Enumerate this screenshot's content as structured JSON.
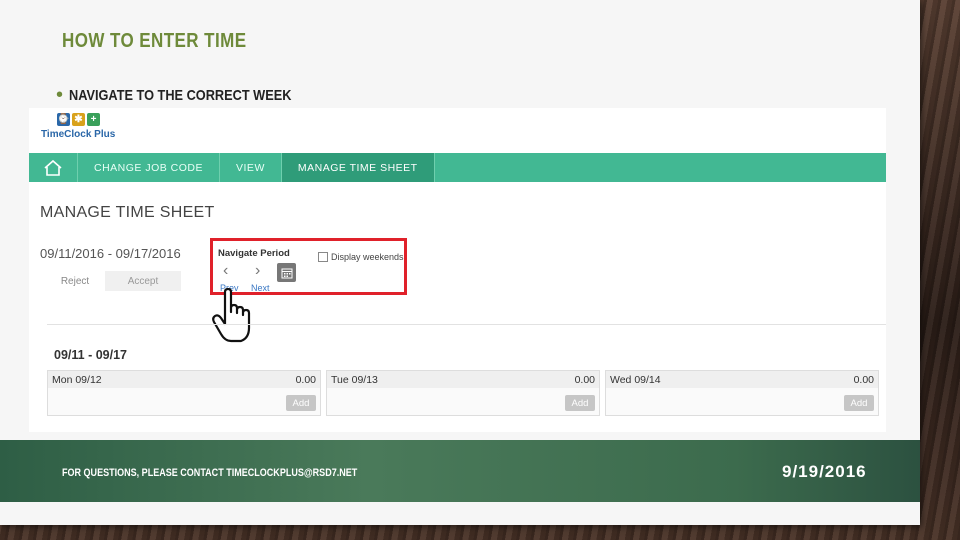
{
  "slide": {
    "title": "HOW TO ENTER TIME",
    "bullet": "NAVIGATE TO THE CORRECT WEEK"
  },
  "app": {
    "logo_text": "TimeClock Plus",
    "nav": {
      "items": [
        {
          "label": "CHANGE  JOB  CODE"
        },
        {
          "label": "VIEW"
        },
        {
          "label": "MANAGE  TIME  SHEET"
        }
      ]
    },
    "page_title": "MANAGE TIME SHEET",
    "period_range": "09/11/2016 - 09/17/2016",
    "reject_label": "Reject",
    "accept_label": "Accept",
    "navigate_period": {
      "label": "Navigate Period",
      "weekends_label": "Display weekends",
      "prev_label": "Prev",
      "next_label": "Next"
    },
    "week_label": "09/11 - 09/17",
    "days": [
      {
        "day": "Mon 09/12",
        "hours": "0.00",
        "add": "Add"
      },
      {
        "day": "Tue 09/13",
        "hours": "0.00",
        "add": "Add"
      },
      {
        "day": "Wed 09/14",
        "hours": "0.00",
        "add": "Add"
      }
    ]
  },
  "footer": {
    "contact": "FOR QUESTIONS, PLEASE CONTACT TIMECLOCKPLUS@RSD7.NET",
    "date": "9/19/2016"
  },
  "colors": {
    "accent_green": "#6e8a3a",
    "navbar": "#42b893",
    "highlight": "#e0212a"
  }
}
